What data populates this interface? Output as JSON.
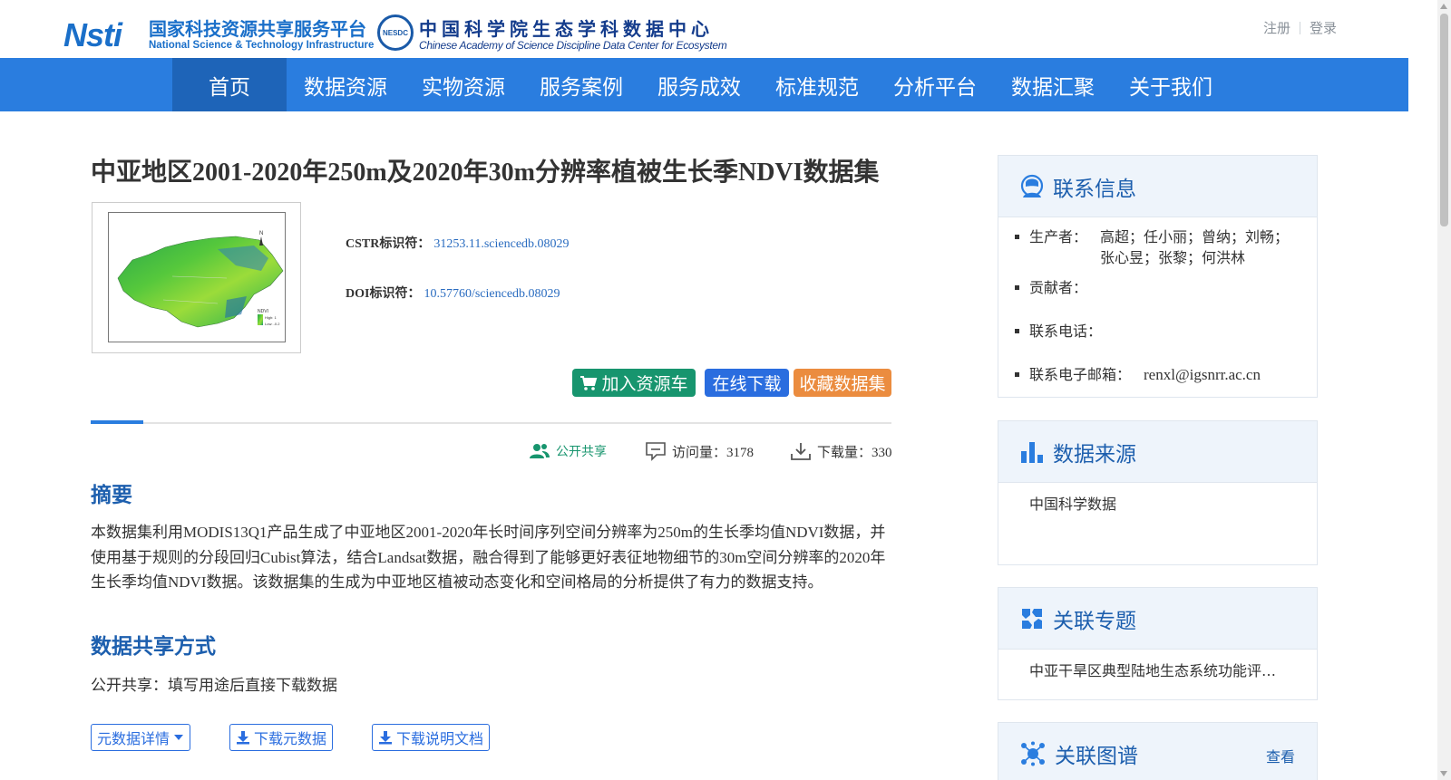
{
  "header": {
    "nsti_mark": "Nsti",
    "nsti_cn": "国家科技资源共享服务平台",
    "nsti_en": "National Science & Technology Infrastructure",
    "nesdc_badge": "NESDC",
    "nesdc_cn": "中国科学院生态学科数据中心",
    "nesdc_en": "Chinese Academy of Science Discipline Data Center for Ecosystem",
    "register": "注册",
    "login": "登录"
  },
  "nav": {
    "items": [
      "首页",
      "数据资源",
      "实物资源",
      "服务案例",
      "服务成效",
      "标准规范",
      "分析平台",
      "数据汇聚",
      "关于我们"
    ],
    "active": "首页"
  },
  "dataset": {
    "title": "中亚地区2001-2020年250m及2020年30m分辨率植被生长季NDVI数据集",
    "cstr_label": "CSTR标识符：",
    "cstr_value": "31253.11.sciencedb.08029",
    "doi_label": "DOI标识符：",
    "doi_value": "10.57760/sciencedb.08029"
  },
  "actions": {
    "cart": "加入资源车",
    "download": "在线下载",
    "favorite": "收藏数据集"
  },
  "stats": {
    "share": "公开共享",
    "visits": "访问量：3178",
    "downloads": "下载量：330"
  },
  "abstract": {
    "heading": "摘要",
    "text": "本数据集利用MODIS13Q1产品生成了中亚地区2001-2020年长时间序列空间分辨率为250m的生长季均值NDVI数据，并使用基于规则的分段回归Cubist算法，结合Landsat数据，融合得到了能够更好表征地物细节的30m空间分辨率的2020年生长季均值NDVI数据。该数据集的生成为中亚地区植被动态变化和空间格局的分析提供了有力的数据支持。"
  },
  "sharing": {
    "heading": "数据共享方式",
    "text": "公开共享：填写用途后直接下载数据"
  },
  "bottom_buttons": {
    "metadata": "元数据详情",
    "download_meta": "下载元数据",
    "download_doc": "下载说明文档"
  },
  "sidebar": {
    "contact": {
      "title": "联系信息",
      "producer_label": "生产者：",
      "producer_value": "高超；任小丽；曾纳；刘畅；张心昱；张黎；何洪林",
      "contributor_label": "贡献者：",
      "phone_label": "联系电话：",
      "email_label": "联系电子邮箱：",
      "email_value": "renxl@igsnrr.ac.cn"
    },
    "source": {
      "title": "数据来源",
      "value": "中国科学数据"
    },
    "topic": {
      "title": "关联专题",
      "value": "中亚干旱区典型陆地生态系统功能评…"
    },
    "graph": {
      "title": "关联图谱",
      "more": "查看"
    }
  },
  "thumbnail_labels": {
    "legend_title": "NDVI",
    "legend_high": "High: 1",
    "legend_low": "Low: -0.2",
    "north": "N"
  },
  "colors": {
    "primary": "#2a7ddf",
    "nav_active": "#1e64b8",
    "heading": "#1d5fae",
    "link": "#2a6cc0",
    "cart": "#17956e",
    "favorite": "#eb8c3f"
  }
}
